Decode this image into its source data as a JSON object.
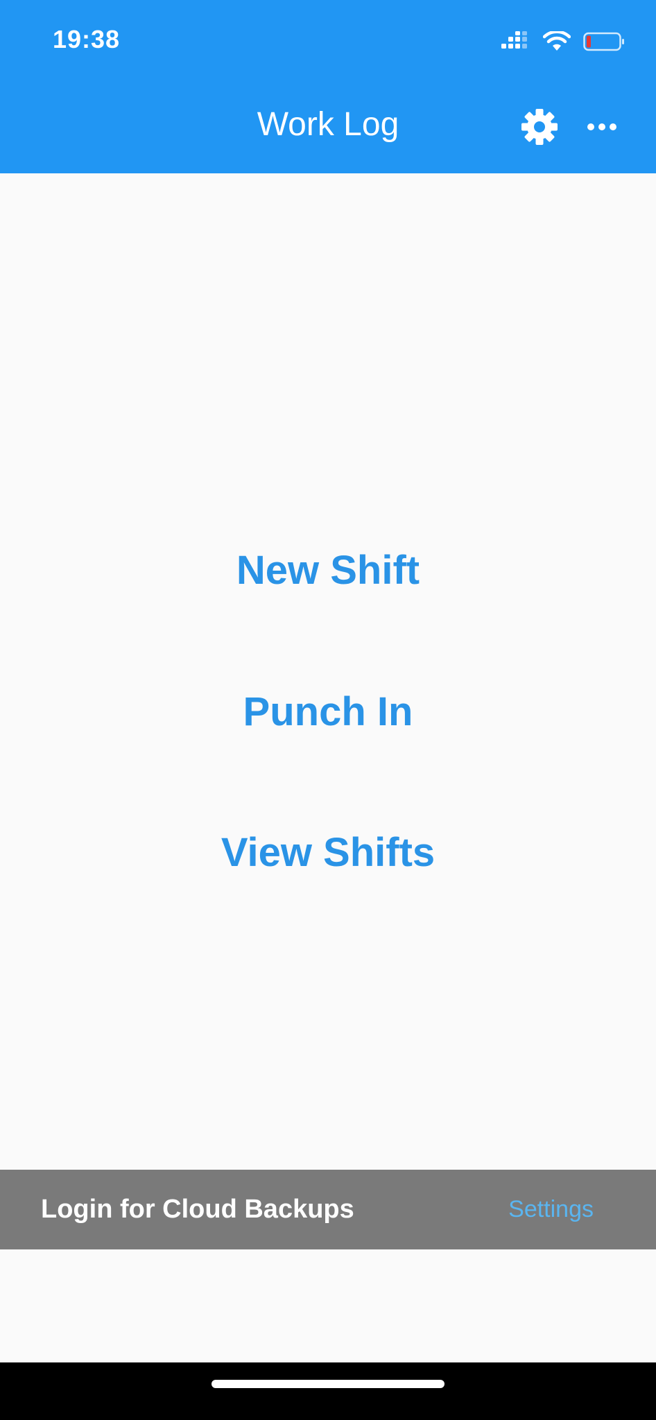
{
  "status_bar": {
    "time": "19:38",
    "icons": [
      "signal-icon",
      "wifi-icon",
      "battery-icon"
    ]
  },
  "app_bar": {
    "title": "Work Log",
    "actions": [
      "gear-icon",
      "more-icon"
    ]
  },
  "menu": {
    "new_shift": "New Shift",
    "punch_in": "Punch In",
    "view_shifts": "View Shifts"
  },
  "cloud_banner": {
    "label": "Login for Cloud Backups",
    "action": "Settings"
  },
  "colors": {
    "primary": "#2196f3",
    "button_text": "#2a93e6",
    "banner_bg": "#7a7a7a",
    "banner_link": "#5ab5f0",
    "battery_low": "#e53935"
  }
}
